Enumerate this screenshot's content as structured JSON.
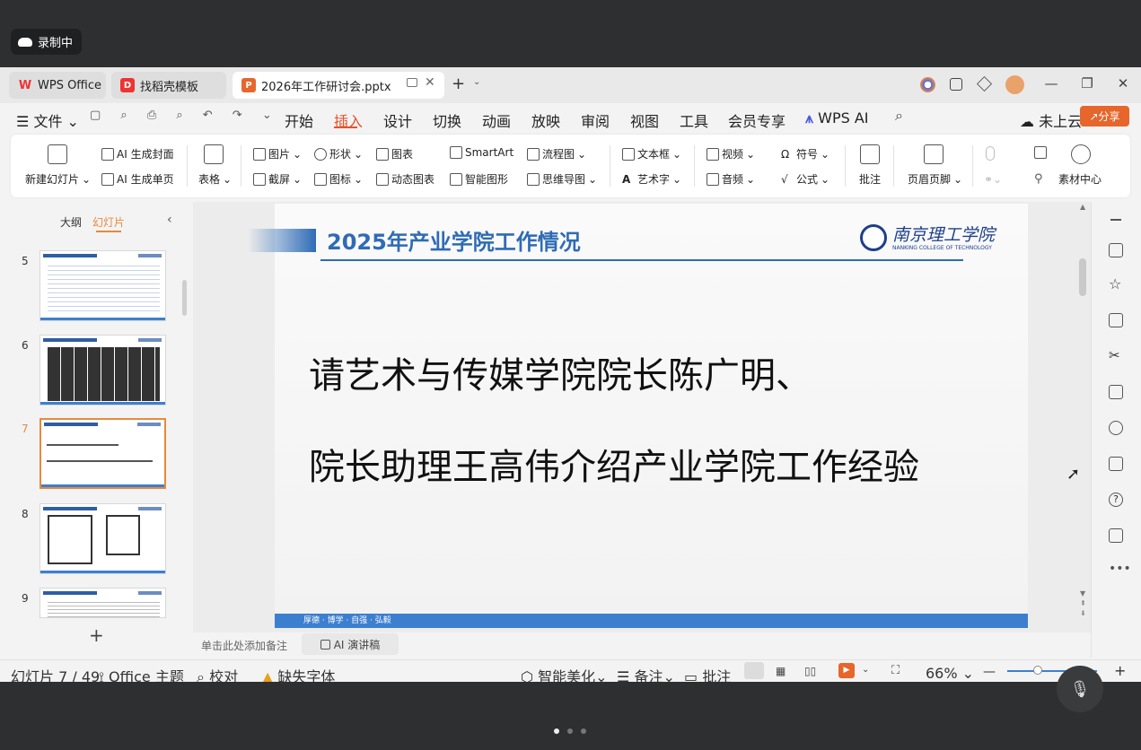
{
  "recording": {
    "label": "录制中"
  },
  "tabs": [
    {
      "label": "WPS Office",
      "icon": "wps-icon"
    },
    {
      "label": "找稻壳模板",
      "icon": "docer-icon"
    },
    {
      "label": "2026年工作研讨会.pptx",
      "icon": "ppt-icon"
    }
  ],
  "menu": {
    "file": "文件",
    "items": [
      "开始",
      "插入",
      "设计",
      "切换",
      "动画",
      "放映",
      "审阅",
      "视图",
      "工具",
      "会员专享"
    ],
    "active": "插入",
    "wps_ai": "WPS AI",
    "cloud": "未上云",
    "share": "分享"
  },
  "ribbon": {
    "new_slide": "新建幻灯片",
    "ai_cover": "AI 生成封面",
    "ai_page": "AI 生成单页",
    "table": "表格",
    "picture": "图片",
    "screenshot": "截屏",
    "shape": "形状",
    "icon": "图标",
    "chart": "图表",
    "dynamic_chart": "动态图表",
    "smartart": "SmartArt",
    "smart_graphic": "智能图形",
    "flowchart": "流程图",
    "mindmap": "思维导图",
    "textbox": "文本框",
    "wordart": "艺术字",
    "video": "视频",
    "audio": "音频",
    "symbol": "符号",
    "formula": "公式",
    "comment": "批注",
    "header_footer": "页眉页脚",
    "material": "素材中心"
  },
  "panel": {
    "outline": "大纲",
    "slides": "幻灯片",
    "thumb_numbers": [
      "5",
      "6",
      "7",
      "8",
      "9"
    ],
    "selected": "7"
  },
  "slide": {
    "title": "2025年产业学院工作情况",
    "line1": "请艺术与传媒学院院长陈广明、",
    "line2": "院长助理王高伟介绍产业学院工作经验",
    "logo_cn": "南京理工学院",
    "logo_en": "NANKING COLLEGE OF TECHNOLOGY",
    "footer": "厚德 · 博学 · 自强 · 弘毅"
  },
  "notes": {
    "placeholder": "单击此处添加备注",
    "ai_speech": "AI 演讲稿"
  },
  "status": {
    "slide_index": "幻灯片 7 / 49",
    "theme": "Office 主题",
    "proof": "校对",
    "missing_font": "缺失字体",
    "beautify": "智能美化",
    "notes": "备注",
    "comments": "批注",
    "zoom": "66%"
  }
}
